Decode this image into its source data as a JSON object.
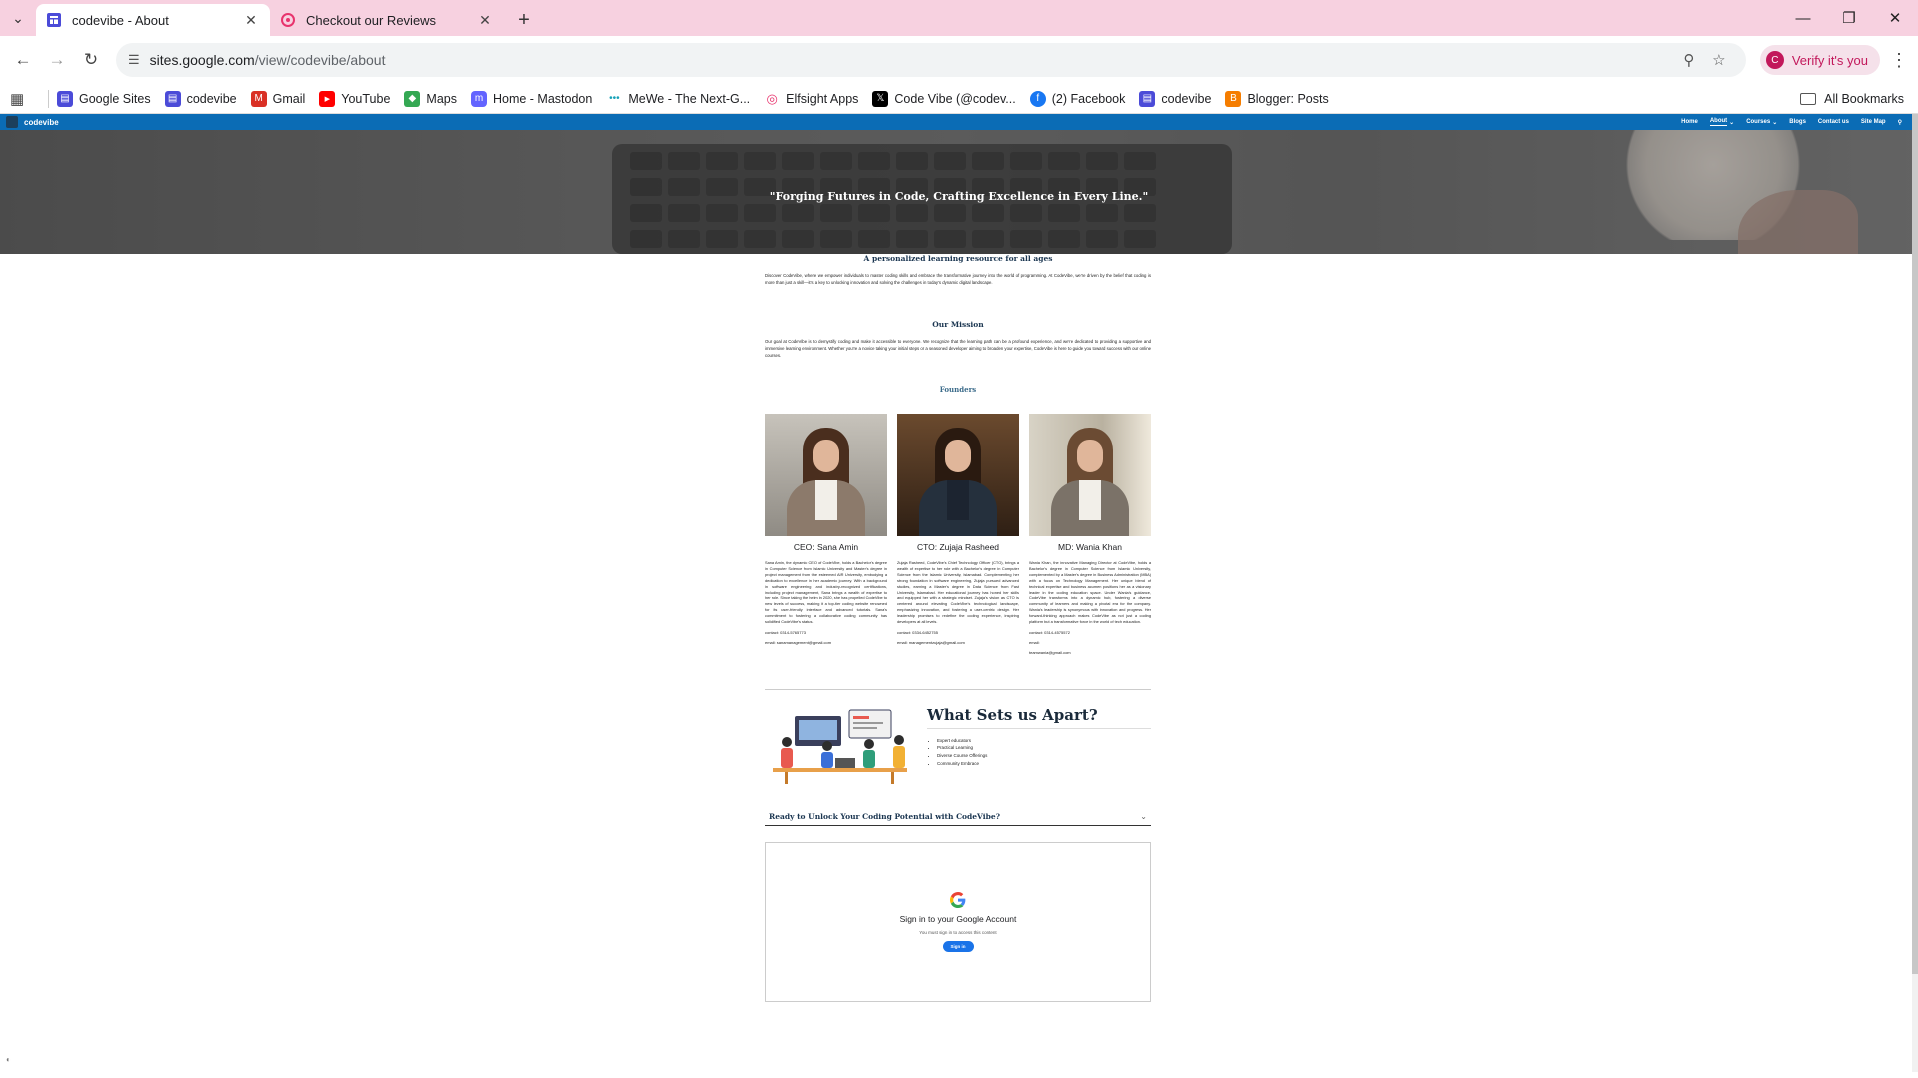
{
  "browser": {
    "tabs": [
      {
        "title": "codevibe - About",
        "icon": "google-sites-icon",
        "active": true
      },
      {
        "title": "Checkout our Reviews",
        "icon": "elfsight-icon",
        "active": false
      }
    ],
    "url_host": "sites.google.com",
    "url_path": "/view/codevibe/about",
    "profile_label": "Verify it's you",
    "profile_initial": "C",
    "bookmarks": [
      {
        "label": "Google Sites",
        "icon": "google-sites-icon",
        "color": "#4b4bd8"
      },
      {
        "label": "codevibe",
        "icon": "google-sites-icon",
        "color": "#4b4bd8"
      },
      {
        "label": "Gmail",
        "icon": "gmail-icon",
        "color": "#d93025"
      },
      {
        "label": "YouTube",
        "icon": "youtube-icon",
        "color": "#ff0000"
      },
      {
        "label": "Maps",
        "icon": "maps-icon",
        "color": "#34a853"
      },
      {
        "label": "Home - Mastodon",
        "icon": "mastodon-icon",
        "color": "#6364ff"
      },
      {
        "label": "MeWe - The Next-G...",
        "icon": "mewe-icon",
        "color": "#17a2b8"
      },
      {
        "label": "Elfsight Apps",
        "icon": "elfsight-icon",
        "color": "#e8336d"
      },
      {
        "label": "Code Vibe (@codev...",
        "icon": "x-icon",
        "color": "#000000"
      },
      {
        "label": "(2) Facebook",
        "icon": "facebook-icon",
        "color": "#1877f2"
      },
      {
        "label": "codevibe",
        "icon": "google-sites-icon",
        "color": "#4b4bd8"
      },
      {
        "label": "Blogger: Posts",
        "icon": "blogger-icon",
        "color": "#f57d00"
      }
    ],
    "all_bookmarks_label": "All Bookmarks"
  },
  "site": {
    "name": "codevibe",
    "nav": [
      "Home",
      "About",
      "Courses",
      "Blogs",
      "Contact us",
      "Site Map"
    ],
    "nav_active": "About",
    "hero_quote": "\"Forging Futures in Code, Crafting Excellence in Every Line.\"",
    "intro": {
      "heading": "A personalized learning resource for all ages",
      "text": "Discover CodeVibe, where we empower individuals to master coding skills and embrace the transformative journey into the world of programming. At CodeVibe, we're driven by the belief that coding is more than just a skill—it's a key to unlocking innovation and solving the challenges in today's dynamic digital landscape."
    },
    "mission": {
      "heading": "Our Mission",
      "text": "Our goal at CodeVibe is to demystify coding and make it accessible to everyone. We recognize that the learning path can be a profound experience, and we're dedicated to providing a supportive and immersive learning environment. Whether you're a novice taking your initial steps or a seasoned developer aiming to broaden your expertise, CodeVibe is here to guide you toward success with our online courses."
    },
    "founders_heading": "Founders",
    "founders": [
      {
        "name": "CEO: Sana Amin",
        "bio": "Sana Amin, the dynamic CEO of CodeVibe, holds a Bachelor's degree in Computer Science from Islamic University and Master's degree in project management from the esteemed AIR University, embodying a dedication to excellence in her academic journey. With a background in software engineering and industry-recognized certifications, including project management, Sana brings a wealth of expertise to her role. Since taking the helm in 2020, she has propelled CodeVibe to new levels of success, making it a top-tier coding website renowned for its user-friendly interface and advanced tutorials. Sana's commitment to fostering a collaborative coding community has solidified CodeVibe's status.",
        "contact": "contact: 0314-5765773",
        "email": "email: sanamanagement@gmail.com"
      },
      {
        "name": "CTO: Zujaja Rasheed",
        "bio": "Zujaja Rasheed, CodeVibe's Chief Technology Officer (CTO), brings a wealth of expertise to her role with a Bachelor's degree in Computer Science from the Islamic University, Islamabad. Complementing her strong foundation in software engineering, Zujaja pursued advanced studies, earning a Master's degree in Data Science from Fast University, Islamabad. Her educational journey has honed her skills and equipped her with a strategic mindset. Zujaja's vision as CTO is centered around elevating CodeVibe's technological landscape, emphasizing innovation, and fostering a user-centric design. Her leadership promises to redefine the coding experience, inspiring developers at all levels.",
        "contact": "contact: 0334-6452755",
        "email": "email: managementzujaja@gmail.com"
      },
      {
        "name": "MD: Wania Khan",
        "bio": "Wania Khan, the innovative Managing Director at CodeVibe, holds a Bachelor's degree in Computer Science from Islamic University, complemented by a Master's degree in Business Administration (MBA) with a focus on Technology Management. Her unique blend of technical expertise and business acumen positions her as a visionary leader in the coding education space. Under Wania's guidance, CodeVibe transforms into a dynamic hub, fostering a diverse community of learners and making a pivotal era for the company. Wania's leadership is synonymous with innovation and progress. Her forward-thinking approach makes CodeVibe as not just a coding platform but a transformative force in the world of tech education.",
        "contact": "contact: 0314-4575572",
        "email": "email:",
        "email2": "teamwania@gmail.com"
      }
    ],
    "apart": {
      "heading": "What Sets us Apart?",
      "items": [
        "Expert educators",
        "Practical Learning",
        "Diverse Course Offerings",
        "Community Embrace"
      ]
    },
    "accordion_label": "Ready to Unlock Your Coding Potential with CodeVibe?",
    "signin": {
      "title": "Sign in to your Google Account",
      "subtitle": "You must sign in to access this content",
      "button": "Sign in"
    }
  }
}
